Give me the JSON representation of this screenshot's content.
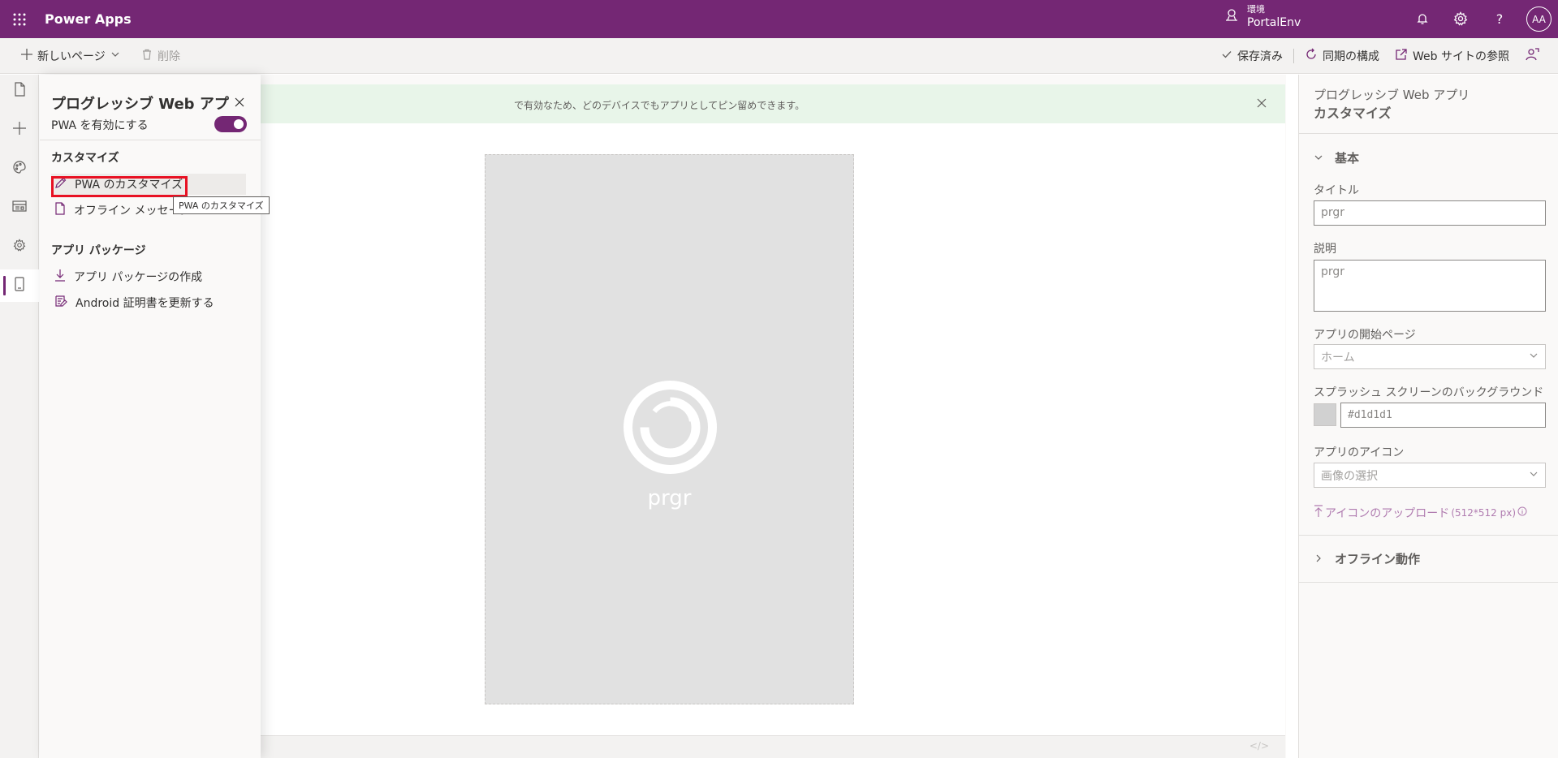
{
  "topbar": {
    "app_title": "Power Apps",
    "env_label": "環境",
    "env_name": "PortalEnv",
    "avatar_initials": "AA"
  },
  "commandbar": {
    "new_page": "新しいページ",
    "delete": "削除",
    "saved": "保存済み",
    "sync": "同期の構成",
    "browse": "Web サイトの参照"
  },
  "sidepanel": {
    "title": "プログレッシブ Web アプリ",
    "enable_pwa": "PWA を有効にする",
    "customize_section": "カスタマイズ",
    "items_customize": [
      "PWA のカスタマイズ",
      "オフライン メッセージ"
    ],
    "package_section": "アプリ パッケージ",
    "items_package": [
      "アプリ パッケージの作成",
      "Android 証明書を更新する"
    ],
    "tooltip": "PWA のカスタマイズ"
  },
  "canvas": {
    "message": "で有効なため、どのデバイスでもアプリとしてピン留めできます。",
    "app_name": "prgr"
  },
  "properties": {
    "subtitle": "プログレッシブ Web アプリ",
    "title": "カスタマイズ",
    "basic_group": "基本",
    "title_label": "タイトル",
    "title_value": "prgr",
    "desc_label": "説明",
    "desc_value": "prgr",
    "start_page_label": "アプリの開始ページ",
    "start_page_value": "ホーム",
    "splash_label": "スプラッシュ スクリーンのバックグラウンド",
    "splash_value": "#d1d1d1",
    "icon_label": "アプリのアイコン",
    "icon_select": "画像の選択",
    "upload_link": "アイコンのアップロード",
    "upload_hint": "(512*512 px)",
    "offline_group": "オフライン動作"
  },
  "colors": {
    "brand": "#742774",
    "highlight": "#e81123",
    "splash": "#d1d1d1"
  }
}
